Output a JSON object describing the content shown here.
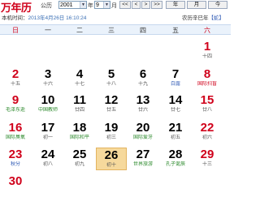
{
  "app": {
    "logo_text": "万年历"
  },
  "toolbar": {
    "calendar_type": "公历",
    "year": "2001",
    "month": "9",
    "month_suffix": "月",
    "prev_year": "<<",
    "prev_month": "<",
    "next_month": ">",
    "next_year": ">>",
    "year_button": "年",
    "month_button": "月",
    "today_button": "今"
  },
  "info": {
    "local_time_label": "本机时间：",
    "local_time": "2013年4月26日 16:10:24",
    "lunar_prefix": "农历辛巳年",
    "lunar_link": "【蛇】"
  },
  "weekdays": [
    "日",
    "一",
    "二",
    "三",
    "四",
    "五",
    "六"
  ],
  "weeks": [
    [
      null,
      null,
      null,
      null,
      null,
      null,
      {
        "d": "1",
        "s": "十四",
        "dc": "red"
      }
    ],
    [
      {
        "d": "2",
        "s": "十五",
        "dc": "red"
      },
      {
        "d": "3",
        "s": "十六"
      },
      {
        "d": "4",
        "s": "十七"
      },
      {
        "d": "5",
        "s": "十八"
      },
      {
        "d": "6",
        "s": "十九"
      },
      {
        "d": "7",
        "s": "白露",
        "sc": "blue"
      },
      {
        "d": "8",
        "s": "国际扫盲",
        "dc": "red",
        "sc": "red"
      }
    ],
    [
      {
        "d": "9",
        "s": "毛泽东逝",
        "dc": "red",
        "sc": "green"
      },
      {
        "d": "10",
        "s": "中国教师",
        "sc": "green"
      },
      {
        "d": "11",
        "s": "廿四"
      },
      {
        "d": "12",
        "s": "廿五"
      },
      {
        "d": "13",
        "s": "廿六"
      },
      {
        "d": "14",
        "s": "廿七"
      },
      {
        "d": "15",
        "s": "廿八",
        "dc": "red"
      }
    ],
    [
      {
        "d": "16",
        "s": "国际臭氧",
        "dc": "red",
        "sc": "green"
      },
      {
        "d": "17",
        "s": "初一"
      },
      {
        "d": "18",
        "s": "国际和平",
        "sc": "green"
      },
      {
        "d": "19",
        "s": "初三"
      },
      {
        "d": "20",
        "s": "国际爱牙",
        "sc": "green"
      },
      {
        "d": "21",
        "s": "初五"
      },
      {
        "d": "22",
        "s": "初六",
        "dc": "red"
      }
    ],
    [
      {
        "d": "23",
        "s": "秋分",
        "dc": "red",
        "sc": "blue"
      },
      {
        "d": "24",
        "s": "初八"
      },
      {
        "d": "25",
        "s": "初九"
      },
      {
        "d": "26",
        "s": "初十",
        "today": true
      },
      {
        "d": "27",
        "s": "世界旅游",
        "sc": "green"
      },
      {
        "d": "28",
        "s": "孔子诞辰",
        "sc": "green"
      },
      {
        "d": "29",
        "s": "十三",
        "dc": "red"
      }
    ],
    [
      {
        "d": "30",
        "s": "",
        "dc": "red"
      },
      null,
      null,
      null,
      null,
      null,
      null
    ]
  ]
}
